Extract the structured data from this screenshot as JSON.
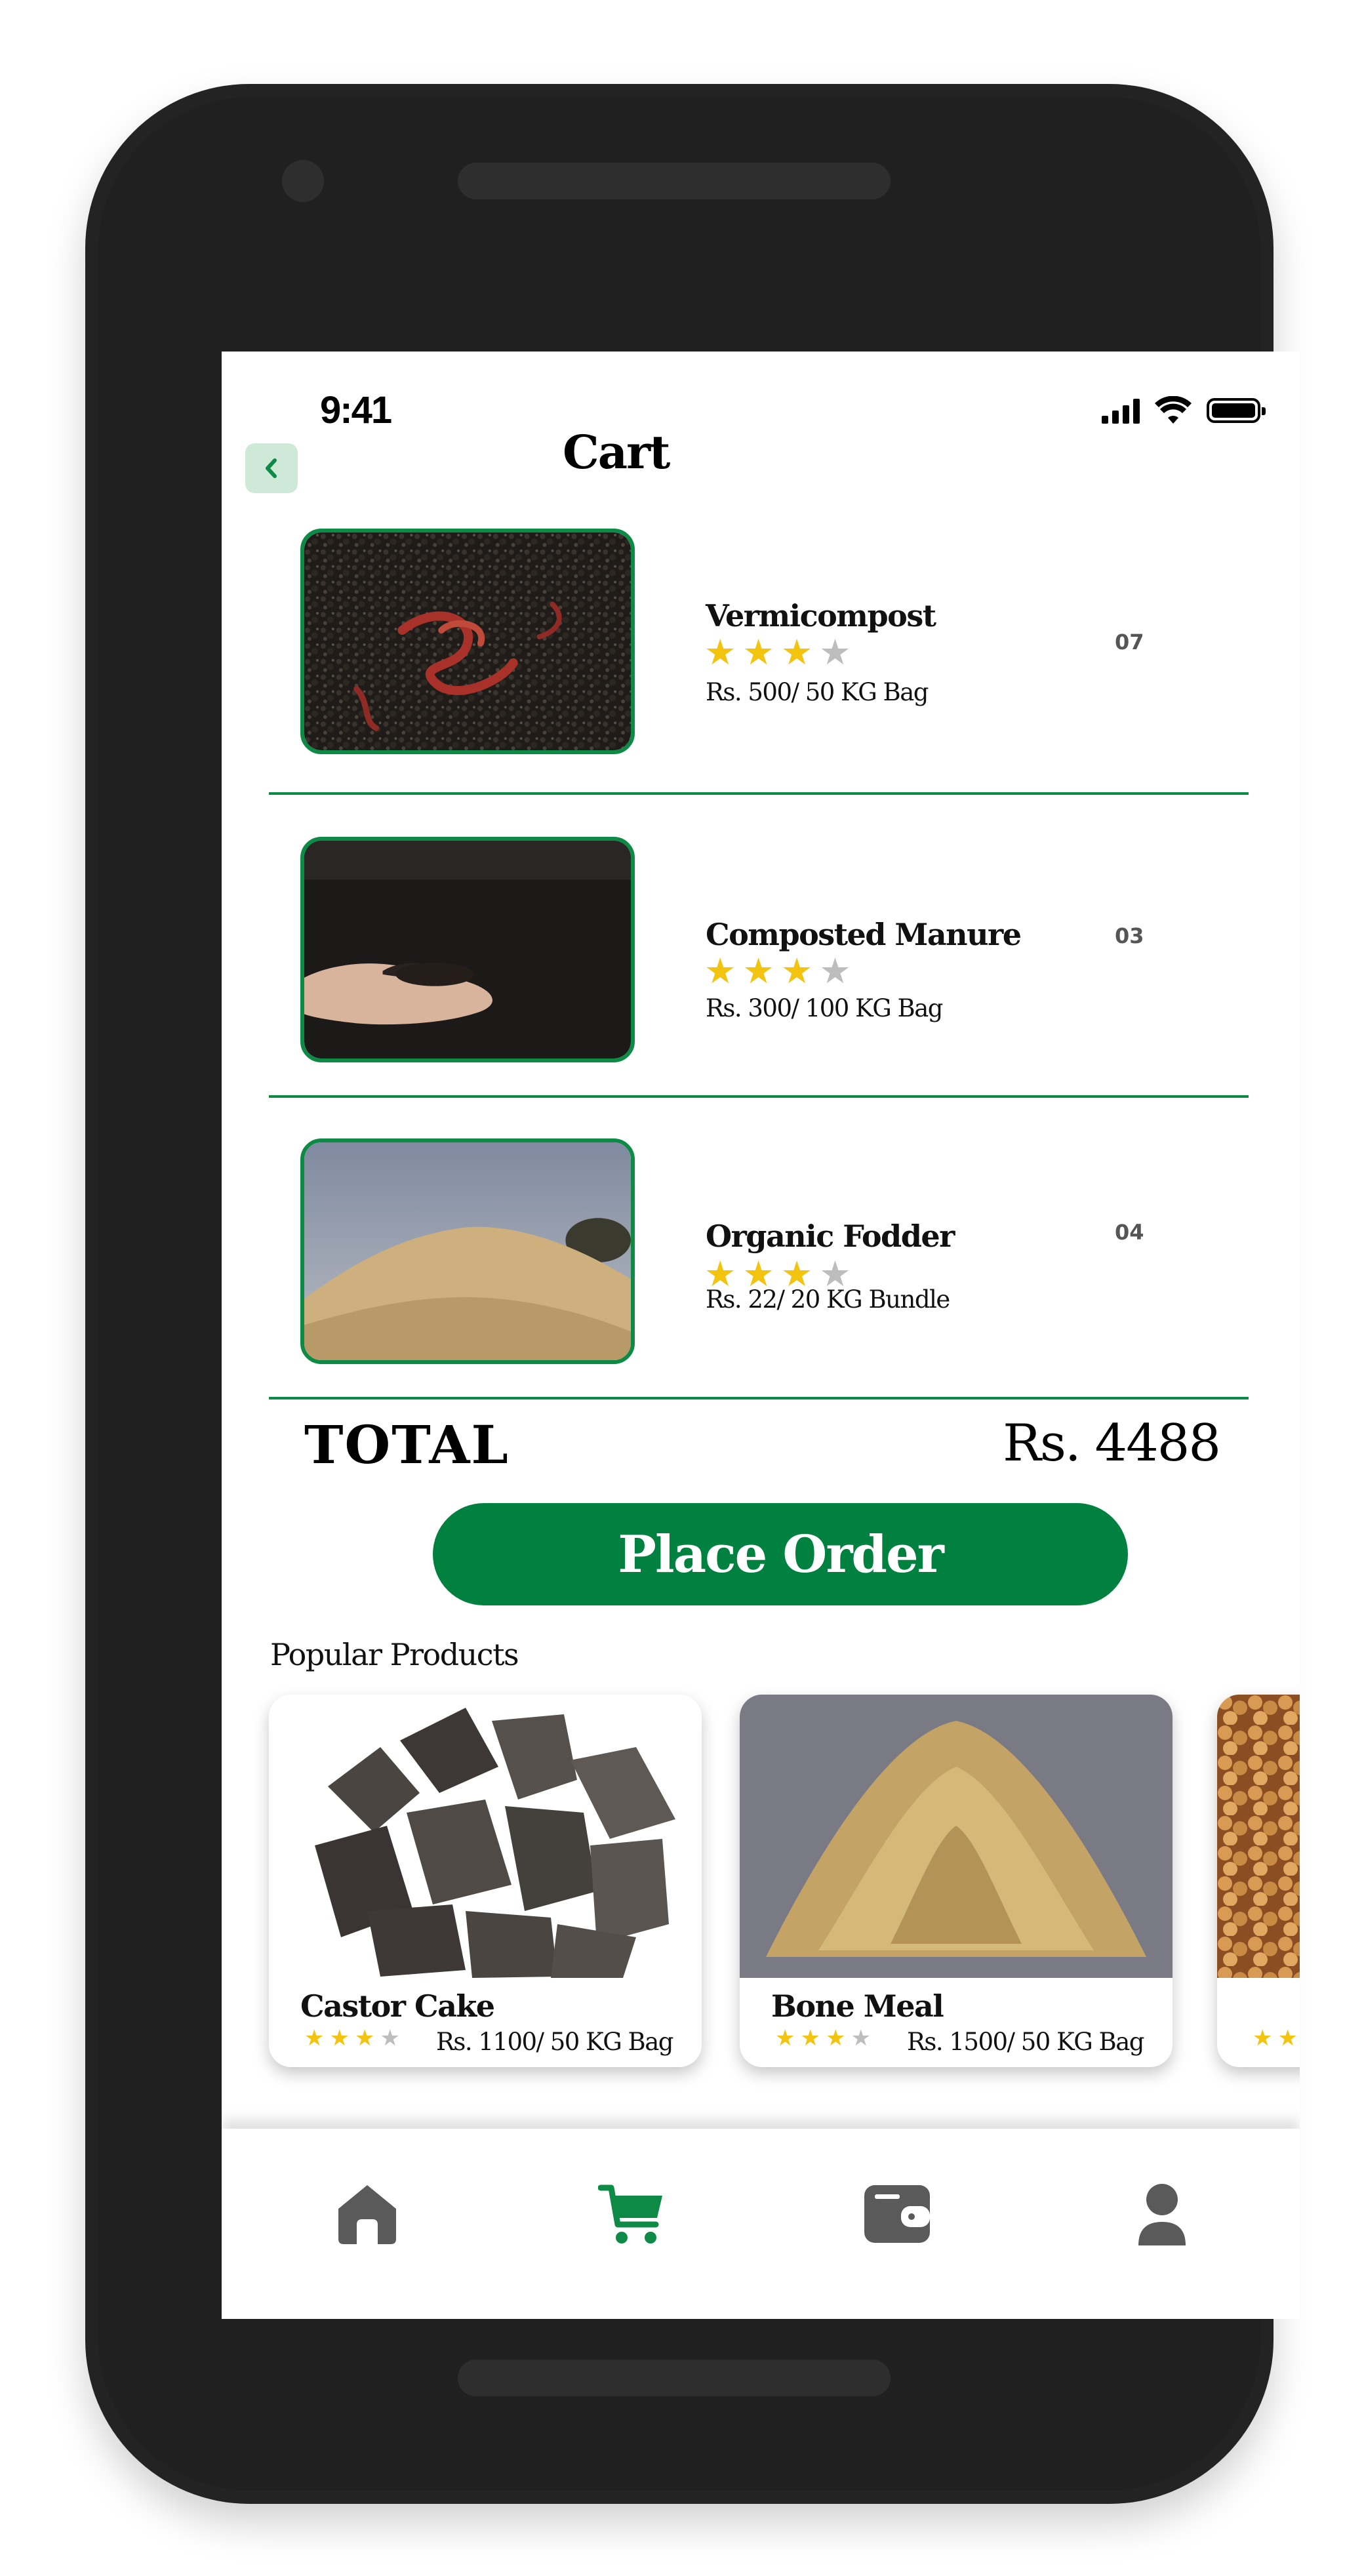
{
  "status_bar": {
    "time": "9:41"
  },
  "header": {
    "title": "Cart",
    "back_icon": "chevron-left-icon"
  },
  "cart": {
    "items": [
      {
        "name": "Vermicompost",
        "rating": 3,
        "max_rating": 4,
        "price": "Rs. 500/ 50 KG Bag",
        "quantity": "07"
      },
      {
        "name": "Composted Manure",
        "rating": 3,
        "max_rating": 4,
        "price": "Rs. 300/ 100 KG Bag",
        "quantity": "03"
      },
      {
        "name": "Organic Fodder",
        "rating": 3,
        "max_rating": 4,
        "price": "Rs. 22/ 20 KG Bundle",
        "quantity": "04"
      }
    ],
    "total_label": "TOTAL",
    "total_value": "Rs. 4488",
    "place_order_label": "Place Order"
  },
  "popular": {
    "title": "Popular Products",
    "products": [
      {
        "name": "Castor Cake",
        "rating": 3,
        "max_rating": 4,
        "price": "Rs. 1100/ 50 KG Bag"
      },
      {
        "name": "Bone Meal",
        "rating": 3,
        "max_rating": 4,
        "price": "Rs. 1500/ 50 KG Bag"
      }
    ]
  },
  "nav": {
    "items": [
      {
        "icon": "home-icon",
        "active": false
      },
      {
        "icon": "cart-icon",
        "active": true
      },
      {
        "icon": "wallet-icon",
        "active": false
      },
      {
        "icon": "user-icon",
        "active": false
      }
    ]
  },
  "colors": {
    "brand_green": "#008140",
    "border_green": "#0d8a45",
    "star_yellow": "#f2c40f",
    "star_grey": "#bdbdbd",
    "icon_grey": "#5a5a5a"
  }
}
